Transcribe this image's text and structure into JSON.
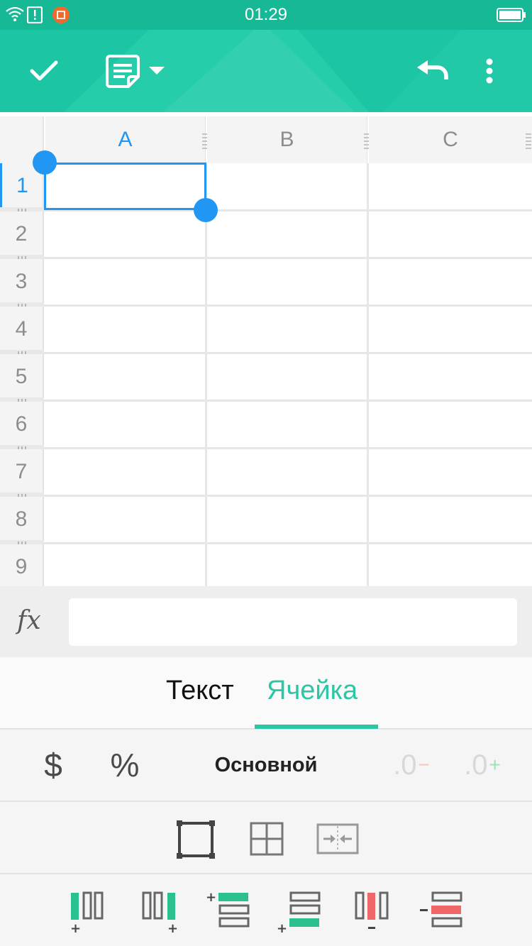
{
  "status_bar": {
    "time": "01:29",
    "icons": [
      "wifi-icon",
      "alert-icon",
      "screenshot-app-icon",
      "battery-icon"
    ]
  },
  "app_bar": {
    "actions": [
      "confirm-check-icon",
      "document-menu-icon",
      "dropdown-caret-icon",
      "undo-icon",
      "more-vert-icon"
    ]
  },
  "sheet": {
    "columns": [
      "A",
      "B",
      "C"
    ],
    "rows": [
      "1",
      "2",
      "3",
      "4",
      "5",
      "6",
      "7",
      "8",
      "9"
    ],
    "selected_cell": "A1"
  },
  "formula_bar": {
    "label": "fx",
    "value": ""
  },
  "tabs": {
    "text_label": "Текст",
    "cell_label": "Ячейка",
    "active": "Ячейка"
  },
  "number_format": {
    "currency_label": "$",
    "percent_label": "%",
    "general_label": "Основной",
    "decrease_decimal_label": ".0",
    "increase_decimal_label": ".0"
  },
  "colors": {
    "app_bar": "#1cc6a4",
    "accent": "#2bc7a5",
    "selection": "#2196f3",
    "insert_green": "#2bc08f",
    "delete_red": "#f06767"
  }
}
